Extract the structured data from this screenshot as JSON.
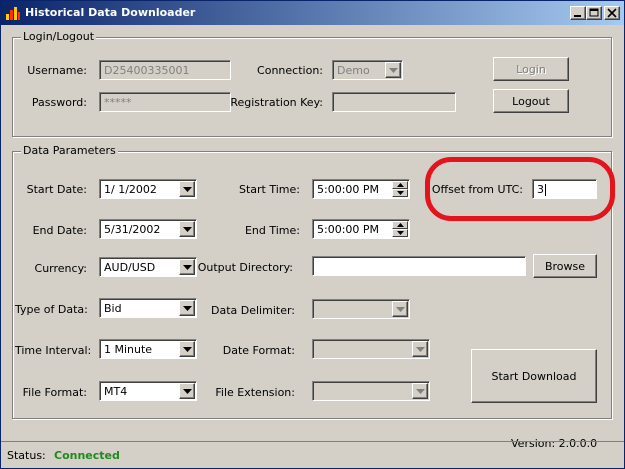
{
  "window": {
    "title": "Historical Data Downloader"
  },
  "login": {
    "group_title": "Login/Logout",
    "username_label": "Username:",
    "username_value": "D25400335001",
    "password_label": "Password:",
    "password_value": "*****",
    "connection_label": "Connection:",
    "connection_value": "Demo",
    "registration_key_label": "Registration Key:",
    "registration_key_value": "",
    "login_button": "Login",
    "logout_button": "Logout"
  },
  "params": {
    "group_title": "Data Parameters",
    "start_date_label": "Start Date:",
    "start_date_value": "1/  1/2002",
    "start_time_label": "Start Time:",
    "start_time_value": "5:00:00 PM",
    "offset_label": "Offset from UTC:",
    "offset_value": "3",
    "end_date_label": "End Date:",
    "end_date_value": "5/31/2002",
    "end_time_label": "End Time:",
    "end_time_value": "5:00:00 PM",
    "currency_label": "Currency:",
    "currency_value": "AUD/USD",
    "output_dir_label": "Output Directory:",
    "output_dir_value": "",
    "browse_button": "Browse",
    "type_label": "Type of Data:",
    "type_value": "Bid",
    "delimiter_label": "Data Delimiter:",
    "delimiter_value": "",
    "interval_label": "Time Interval:",
    "interval_value": "1 Minute",
    "date_format_label": "Date Format:",
    "date_format_value": "",
    "file_format_label": "File Format:",
    "file_format_value": "MT4",
    "file_ext_label": "File Extension:",
    "file_ext_value": "",
    "start_download_button": "Start Download"
  },
  "footer": {
    "version": "Version: 2.0.0.0",
    "status_label": "Status:",
    "status_value": "Connected"
  },
  "colors": {
    "highlight": "#e3141b",
    "status_connected": "#1f8a1f",
    "titlebar_start": "#0a246a",
    "face": "#d4d0c8"
  },
  "icons": [
    "app-icon",
    "minimize-icon",
    "maximize-icon",
    "close-icon",
    "chevron-down-icon",
    "spin-up-icon",
    "spin-down-icon"
  ]
}
